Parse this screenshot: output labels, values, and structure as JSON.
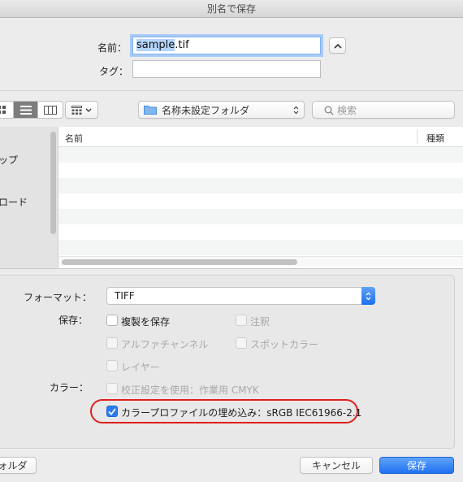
{
  "window": {
    "title": "別名で保存"
  },
  "save_as": {
    "name_label": "名前：",
    "name_value_selected": "sample",
    "name_value_ext": ".tif",
    "tag_label": "タグ：",
    "tag_value": ""
  },
  "toolbar": {
    "location": "名称未設定フォルダ",
    "search_placeholder": "検索"
  },
  "sidebar": {
    "items": [
      "ップ",
      "ロード"
    ]
  },
  "filelist": {
    "col_name": "名前",
    "col_kind": "種類"
  },
  "options": {
    "format_label": "フォーマット：",
    "format_value": "TIFF",
    "save_label": "保存：",
    "color_label": "カラー：",
    "checkboxes": {
      "copy": "複製を保存",
      "notes": "注釈",
      "alpha": "アルファチャンネル",
      "spot": "スポットカラー",
      "layers": "レイヤー",
      "proof": "校正設定を使用：作業用 CMYK",
      "embed_profile": "カラープロファイルの埋め込み：sRGB IEC61966-2.1"
    }
  },
  "footer": {
    "new_folder": "ォルダ",
    "cancel": "キャンセル",
    "save": "保存"
  },
  "colors": {
    "accent": "#1f71f0",
    "highlight_ring": "#e0201c"
  }
}
